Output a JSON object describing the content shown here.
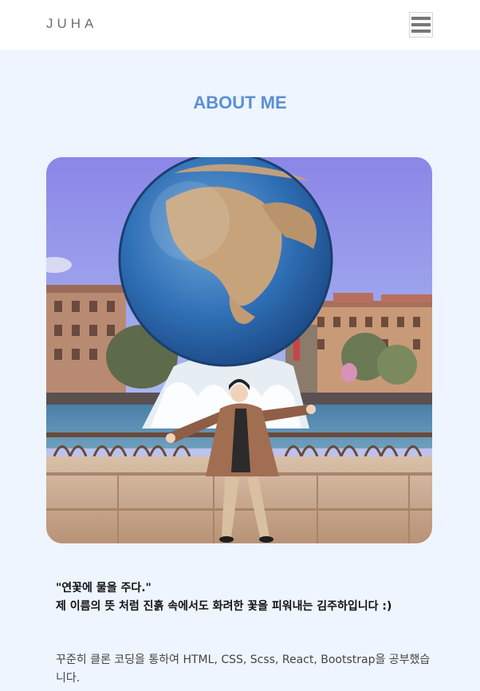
{
  "header": {
    "logo": "JUHA",
    "menu_icon": "hamburger-menu-icon"
  },
  "about": {
    "title": "ABOUT ME",
    "photo_subject": "person-in-front-of-globe-fountain",
    "quote_line1": "\"연꽃에 물을 주다.\"",
    "quote_line2": "제 이름의 뜻 처럼 진흙 속에서도 화려한 꽃을 피워내는 김주하입니다 :)",
    "description": "꾸준히 클론 코딩을 통하여 HTML, CSS, Scss, React, Bootstrap을 공부했습니다."
  },
  "colors": {
    "accent": "#5b8fd6",
    "page_background": "#eef5ff",
    "header_background": "#ffffff"
  }
}
